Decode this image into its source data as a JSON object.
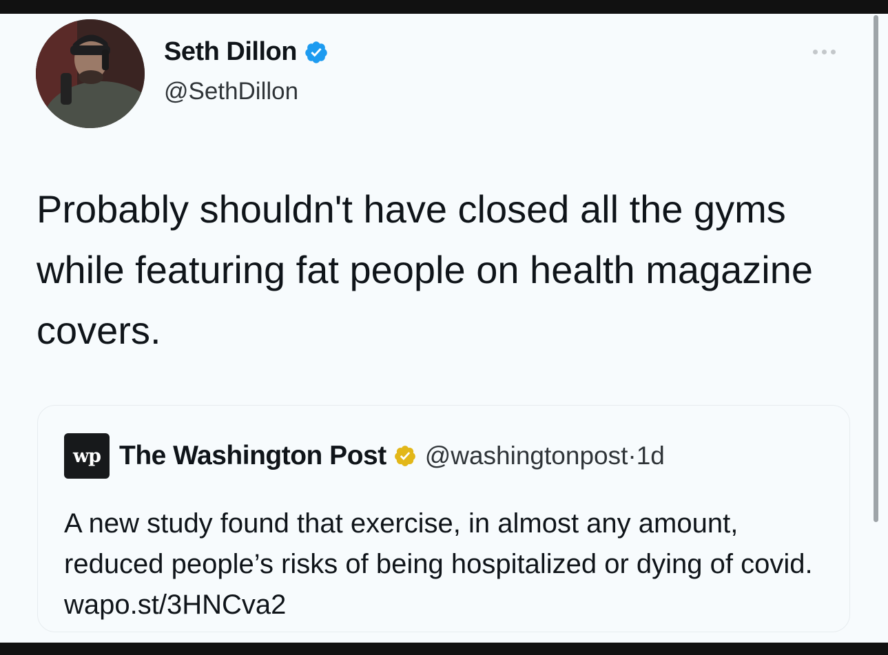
{
  "tweet": {
    "author_name": "Seth Dillon",
    "author_handle": "@SethDillon",
    "text": "Probably shouldn't have closed all the gyms while featuring fat people on health magazine covers."
  },
  "quoted_tweet": {
    "logo_text": "wp",
    "author_name": "The Washington Post",
    "author_handle": "@washingtonpost",
    "separator": " · ",
    "time": "1d",
    "text": "A new study found that exercise, in almost any amount, reduced people’s risks of being hospitalized or dying of covid. wapo.st/3HNCva2"
  },
  "icons": {
    "verified_blue": "verified-badge-icon",
    "verified_gold": "verified-badge-icon",
    "more": "more-options-icon"
  },
  "colors": {
    "background": "#f7fbfd",
    "verified_blue": "#1d9bf0",
    "verified_gold": "#e2b719",
    "text": "#0f1419"
  }
}
